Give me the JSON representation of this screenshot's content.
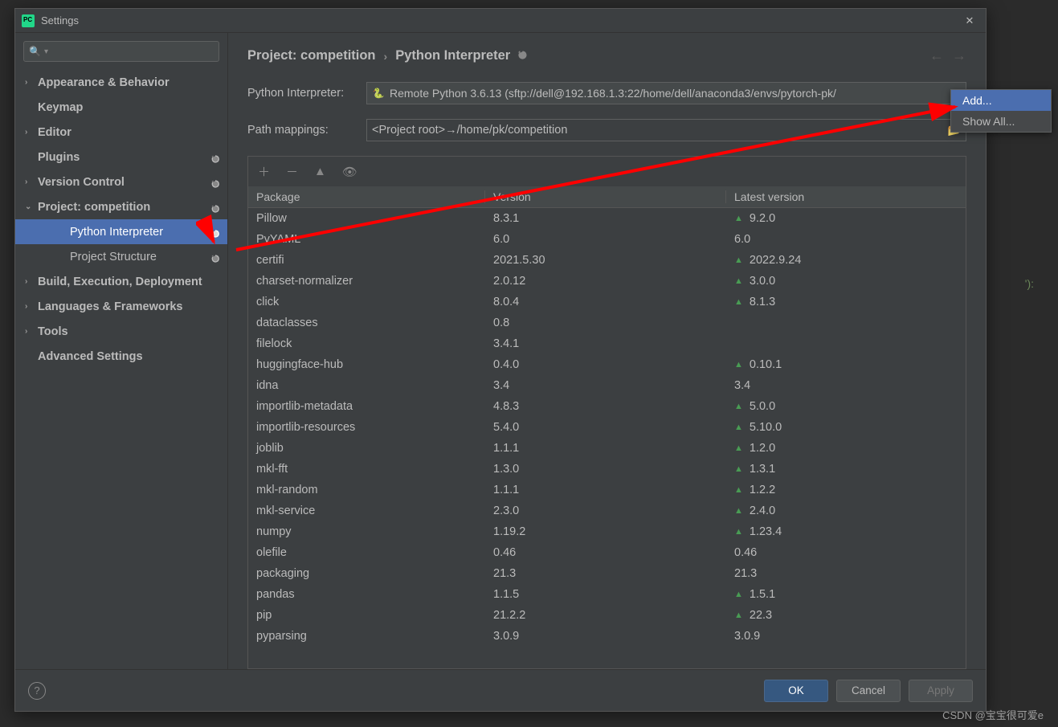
{
  "window": {
    "title": "Settings"
  },
  "sidebar": {
    "search_placeholder": "",
    "items": [
      {
        "label": "Appearance & Behavior",
        "bold": true,
        "chev": "right"
      },
      {
        "label": "Keymap",
        "bold": true,
        "chev": ""
      },
      {
        "label": "Editor",
        "bold": true,
        "chev": "right"
      },
      {
        "label": "Plugins",
        "bold": true,
        "chev": "",
        "dot": true
      },
      {
        "label": "Version Control",
        "bold": true,
        "chev": "right",
        "dot": true
      },
      {
        "label": "Project: competition",
        "bold": true,
        "chev": "down",
        "dot": true
      },
      {
        "label": "Python Interpreter",
        "sub": true,
        "selected": true,
        "dot": true
      },
      {
        "label": "Project Structure",
        "sub": true,
        "dot": true
      },
      {
        "label": "Build, Execution, Deployment",
        "bold": true,
        "chev": "right"
      },
      {
        "label": "Languages & Frameworks",
        "bold": true,
        "chev": "right"
      },
      {
        "label": "Tools",
        "bold": true,
        "chev": "right"
      },
      {
        "label": "Advanced Settings",
        "bold": true,
        "chev": ""
      }
    ]
  },
  "breadcrumb": {
    "a": "Project: competition",
    "b": "Python Interpreter"
  },
  "form": {
    "interpreter_label": "Python Interpreter:",
    "interpreter_value": "Remote Python 3.6.13 (sftp://dell@192.168.1.3:22/home/dell/anaconda3/envs/pytorch-pk/",
    "mappings_label": "Path mappings:",
    "mappings_value": "<Project root>→/home/pk/competition"
  },
  "table": {
    "headers": {
      "pkg": "Package",
      "ver": "Version",
      "lat": "Latest version"
    },
    "rows": [
      {
        "p": "Pillow",
        "v": "8.3.1",
        "l": "9.2.0",
        "up": true
      },
      {
        "p": "PyYAML",
        "v": "6.0",
        "l": "6.0",
        "up": false
      },
      {
        "p": "certifi",
        "v": "2021.5.30",
        "l": "2022.9.24",
        "up": true
      },
      {
        "p": "charset-normalizer",
        "v": "2.0.12",
        "l": "3.0.0",
        "up": true
      },
      {
        "p": "click",
        "v": "8.0.4",
        "l": "8.1.3",
        "up": true
      },
      {
        "p": "dataclasses",
        "v": "0.8",
        "l": "",
        "up": false
      },
      {
        "p": "filelock",
        "v": "3.4.1",
        "l": "",
        "up": false
      },
      {
        "p": "huggingface-hub",
        "v": "0.4.0",
        "l": "0.10.1",
        "up": true
      },
      {
        "p": "idna",
        "v": "3.4",
        "l": "3.4",
        "up": false
      },
      {
        "p": "importlib-metadata",
        "v": "4.8.3",
        "l": "5.0.0",
        "up": true
      },
      {
        "p": "importlib-resources",
        "v": "5.4.0",
        "l": "5.10.0",
        "up": true
      },
      {
        "p": "joblib",
        "v": "1.1.1",
        "l": "1.2.0",
        "up": true
      },
      {
        "p": "mkl-fft",
        "v": "1.3.0",
        "l": "1.3.1",
        "up": true
      },
      {
        "p": "mkl-random",
        "v": "1.1.1",
        "l": "1.2.2",
        "up": true
      },
      {
        "p": "mkl-service",
        "v": "2.3.0",
        "l": "2.4.0",
        "up": true
      },
      {
        "p": "numpy",
        "v": "1.19.2",
        "l": "1.23.4",
        "up": true
      },
      {
        "p": "olefile",
        "v": "0.46",
        "l": "0.46",
        "up": false
      },
      {
        "p": "packaging",
        "v": "21.3",
        "l": "21.3",
        "up": false
      },
      {
        "p": "pandas",
        "v": "1.1.5",
        "l": "1.5.1",
        "up": true
      },
      {
        "p": "pip",
        "v": "21.2.2",
        "l": "22.3",
        "up": true
      },
      {
        "p": "pyparsing",
        "v": "3.0.9",
        "l": "3.0.9",
        "up": false
      }
    ]
  },
  "popup": {
    "add": "Add...",
    "show_all": "Show All..."
  },
  "footer": {
    "ok": "OK",
    "cancel": "Cancel",
    "apply": "Apply"
  },
  "watermark": "CSDN @宝宝很可爱e",
  "code_behind": "'):"
}
